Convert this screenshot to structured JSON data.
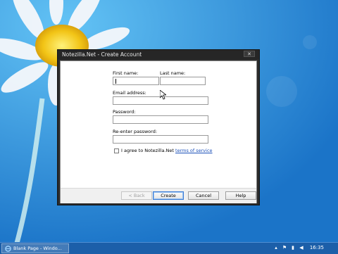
{
  "window": {
    "title": "Notezilla.Net - Create Account",
    "close_glyph": "✕"
  },
  "form": {
    "first_name_label": "First name:",
    "last_name_label": "Last name:",
    "email_label": "Email address:",
    "password_label": "Password:",
    "reenter_password_label": "Re-enter password:",
    "first_name_value": "",
    "last_name_value": "",
    "email_value": "",
    "password_value": "",
    "reenter_password_value": "",
    "agree_text": "I agree to Notezilla.Net",
    "terms_link": "terms of service",
    "agree_checked": false
  },
  "buttons": {
    "back": "< Back",
    "create": "Create",
    "cancel": "Cancel",
    "help": "Help"
  },
  "taskbar": {
    "task_label": "Blank Page - Windo...",
    "task_icon": "internet-explorer-icon",
    "clock": "16:35"
  },
  "colors": {
    "desktop": "#2a90df",
    "window_frame": "#2b2b2b",
    "link": "#1a4fb8"
  }
}
